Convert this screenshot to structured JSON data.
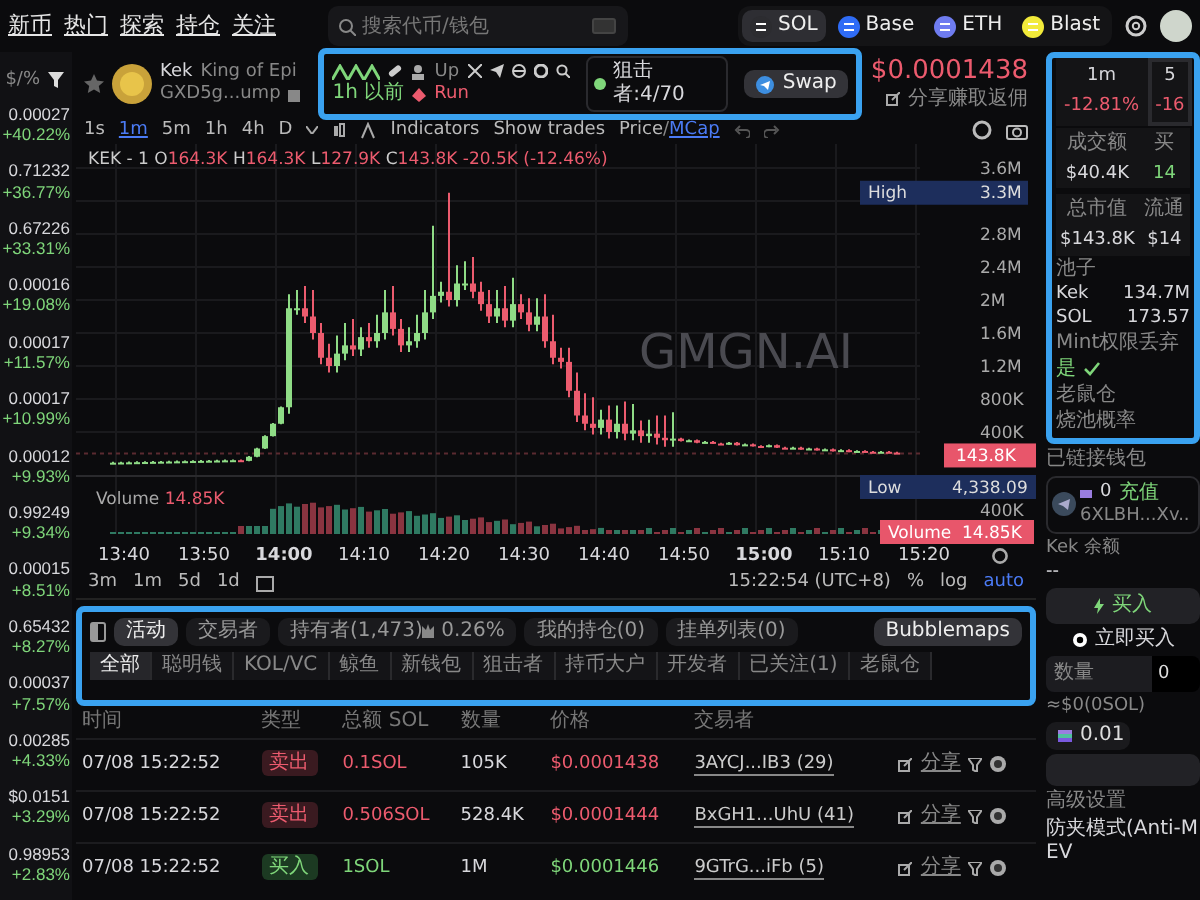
{
  "nav": {
    "items": [
      {
        "label": "新币"
      },
      {
        "label": "热门"
      },
      {
        "label": "探索"
      },
      {
        "label": "持仓"
      },
      {
        "label": "关注"
      }
    ],
    "search": {
      "placeholder": "搜索代币/钱包"
    },
    "chains": [
      {
        "label": "SOL",
        "selected": true,
        "color": "#2c2c30"
      },
      {
        "label": "Base",
        "selected": false,
        "color": "#2f6cf6"
      },
      {
        "label": "ETH",
        "selected": false,
        "color": "#6f7cf0"
      },
      {
        "label": "Blast",
        "selected": false,
        "color": "#f2ea3a"
      }
    ]
  },
  "sidebar": {
    "header": "$/%",
    "items": [
      {
        "price": "0.00027",
        "change": "+40.22%"
      },
      {
        "price": "0.71232",
        "change": "+36.77%"
      },
      {
        "price": "0.67226",
        "change": "+33.31%"
      },
      {
        "price": "0.00016",
        "change": "+19.08%"
      },
      {
        "price": "0.00017",
        "change": "+11.57%"
      },
      {
        "price": "0.00017",
        "change": "+10.99%"
      },
      {
        "price": "0.00012",
        "change": "+9.93%"
      },
      {
        "price": "0.99249",
        "change": "+9.34%"
      },
      {
        "price": "0.00015",
        "change": "+8.51%"
      },
      {
        "price": "0.65432",
        "change": "+8.27%"
      },
      {
        "price": "0.00037",
        "change": "+7.57%"
      },
      {
        "price": "0.00285",
        "change": "+4.33%"
      },
      {
        "price": "$0.0151",
        "change": "+3.29%"
      },
      {
        "price": "0.98953",
        "change": "+2.83%"
      }
    ]
  },
  "token": {
    "name": "Kek",
    "subtitle": "King of Epi",
    "address": "GXD5g...ump",
    "up": "Up",
    "age": "1h 以前",
    "run": "Run",
    "snipers": "狙击者:4/70",
    "swap": "Swap",
    "price": "$0.0001438",
    "share": "分享赚取返佣"
  },
  "toolbar": {
    "intervals": [
      {
        "label": "1s",
        "selected": false
      },
      {
        "label": "1m",
        "selected": true
      },
      {
        "label": "5m",
        "selected": false
      },
      {
        "label": "1h",
        "selected": false
      },
      {
        "label": "4h",
        "selected": false
      },
      {
        "label": "D",
        "selected": false
      }
    ],
    "indicators": "Indicators",
    "show_trades": "Show trades",
    "price": "Price",
    "separator": "/",
    "mcap": "MCap"
  },
  "chart": {
    "symbol": "KEK - 1",
    "ohlc": [
      {
        "label": "O",
        "value": "164.3K"
      },
      {
        "label": "H",
        "value": "164.3K"
      },
      {
        "label": "L",
        "value": "127.9K"
      },
      {
        "label": "C",
        "value": "143.8K"
      }
    ],
    "change": "-20.5K (-12.46%)",
    "watermark": "GMGN.AI",
    "yticks": [
      "3.6M",
      "2.8M",
      "2.4M",
      "2M",
      "1.6M",
      "1.2M",
      "800K",
      "400K"
    ],
    "high": {
      "label": "High",
      "value": "3.3M"
    },
    "last": "143.8K",
    "low": {
      "label": "Low",
      "value": "4,338.09"
    },
    "volume_legend": {
      "label": "Volume",
      "value": "14.85K"
    },
    "volume_tick": "400K",
    "volume": {
      "label": "Volume",
      "value": "14.85K"
    },
    "xticks": [
      {
        "label": "13:40",
        "bold": false
      },
      {
        "label": "13:50",
        "bold": false
      },
      {
        "label": "14:00",
        "bold": true
      },
      {
        "label": "14:10",
        "bold": false
      },
      {
        "label": "14:20",
        "bold": false
      },
      {
        "label": "14:30",
        "bold": false
      },
      {
        "label": "14:40",
        "bold": false
      },
      {
        "label": "14:50",
        "bold": false
      },
      {
        "label": "15:00",
        "bold": true
      },
      {
        "label": "15:10",
        "bold": false
      },
      {
        "label": "15:20",
        "bold": false
      }
    ]
  },
  "range_bar": {
    "ranges": [
      "3m",
      "1m",
      "5d",
      "1d"
    ],
    "time": "15:22:54 (UTC+8)",
    "percent": "%",
    "log": "log",
    "auto": "auto"
  },
  "activity": {
    "tabs": [
      {
        "label": "活动",
        "selected": true
      },
      {
        "label": "交易者",
        "selected": false
      },
      {
        "label": "持有者(1,473)",
        "extra": "0.26%",
        "selected": false
      },
      {
        "label": "我的持仓(0)",
        "selected": false
      },
      {
        "label": "挂单列表(0)",
        "selected": false
      }
    ],
    "bubblemaps": "Bubblemaps",
    "filters": [
      {
        "label": "全部",
        "selected": true
      },
      {
        "label": "聪明钱",
        "selected": false
      },
      {
        "label": "KOL/VC",
        "selected": false
      },
      {
        "label": "鲸鱼",
        "selected": false
      },
      {
        "label": "新钱包",
        "selected": false
      },
      {
        "label": "狙击者",
        "selected": false
      },
      {
        "label": "持币大户",
        "selected": false
      },
      {
        "label": "开发者",
        "selected": false
      },
      {
        "label": "已关注(1)",
        "selected": false
      },
      {
        "label": "老鼠仓",
        "selected": false
      }
    ]
  },
  "table": {
    "columns": [
      "时间",
      "类型",
      "总额 SOL",
      "数量",
      "价格",
      "交易者"
    ],
    "rows": [
      {
        "time": "07/08 15:22:52",
        "type": "卖出",
        "kind": "sell",
        "total": "0.1SOL",
        "amount": "105K",
        "price": "$0.0001438",
        "trader": "3AYCJ...IB3 (29)",
        "share": "分享"
      },
      {
        "time": "07/08 15:22:52",
        "type": "卖出",
        "kind": "sell",
        "total": "0.506SOL",
        "amount": "528.4K",
        "price": "$0.0001444",
        "trader": "BxGH1...UhU (41)",
        "share": "分享"
      },
      {
        "time": "07/08 15:22:52",
        "type": "买入",
        "kind": "buy",
        "total": "1SOL",
        "amount": "1M",
        "price": "$0.0001446",
        "trader": "9GTrG...iFb (5)",
        "share": "分享"
      }
    ]
  },
  "stats": {
    "tabs": [
      {
        "label": "1m",
        "change": "-12.81%",
        "selected": false
      },
      {
        "label": "5",
        "change": "-16",
        "selected": true
      }
    ],
    "cells": [
      {
        "label": "成交额",
        "value": "$40.4K",
        "kind": "plain"
      },
      {
        "label": "买",
        "value": "14",
        "kind": "up"
      },
      {
        "label": "总市值",
        "value": "$143.8K",
        "kind": "plain"
      },
      {
        "label": "流通",
        "value": "$14",
        "kind": "plain"
      }
    ],
    "pool_label": "池子",
    "pool": [
      {
        "label": "Kek",
        "value": "134.7M"
      },
      {
        "label": "SOL",
        "value": "173.57"
      }
    ],
    "mint_label": "Mint权限丢弃",
    "mint_value": "是",
    "mint_ok": true,
    "insider": "老鼠仓",
    "rug": "烧池概率"
  },
  "trade": {
    "wallet_label": "已链接钱包",
    "wallet_balance": "0",
    "deposit": "充值",
    "wallet_address": "6XLBH...Xv..",
    "balance_label": "Kek 余额",
    "balance": "--",
    "buy": "买入",
    "instant": "立即买入",
    "instant_on": true,
    "qty_label": "数量",
    "qty": "0",
    "approx": "≈$0(0SOL)",
    "preset": "0.01",
    "advanced": "高级设置",
    "anti_mev": "防夹模式(Anti-MEV"
  }
}
